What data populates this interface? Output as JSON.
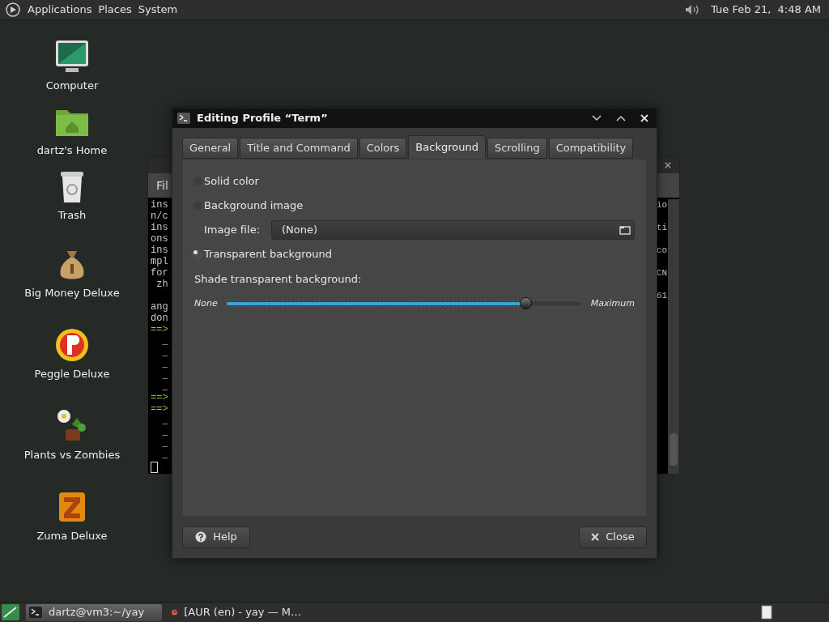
{
  "top_panel": {
    "menus": [
      "Applications",
      "Places",
      "System"
    ],
    "clock": "Tue Feb 21,  4:48 AM"
  },
  "desktop_icons": [
    {
      "label": "Computer",
      "kind": "computer"
    },
    {
      "label": "dartz's Home",
      "kind": "folder"
    },
    {
      "label": "Trash",
      "kind": "trash"
    },
    {
      "label": "Big Money Deluxe",
      "kind": "moneybag"
    },
    {
      "label": "Peggle Deluxe",
      "kind": "ball"
    },
    {
      "label": "Plants vs Zombies",
      "kind": "flower"
    },
    {
      "label": "Zuma Deluxe",
      "kind": "idol"
    }
  ],
  "terminal": {
    "menu": "Fil",
    "left_lines": [
      {
        "text": "ins",
        "kind": "text"
      },
      {
        "text": "n/c",
        "kind": "text"
      },
      {
        "text": "ins",
        "kind": "text"
      },
      {
        "text": "ons",
        "kind": "text"
      },
      {
        "text": "ins",
        "kind": "text"
      },
      {
        "text": "mpl",
        "kind": "text"
      },
      {
        "text": "for",
        "kind": "text"
      },
      {
        "text": " zh",
        "kind": "text"
      },
      {
        "kind": "blank"
      },
      {
        "text": "ang",
        "kind": "text"
      },
      {
        "text": "don",
        "kind": "text"
      },
      {
        "text": "==>",
        "kind": "arrow"
      },
      {
        "text": "  _",
        "kind": "text"
      },
      {
        "text": "  _",
        "kind": "text"
      },
      {
        "text": "  _",
        "kind": "text"
      },
      {
        "text": "  _",
        "kind": "text"
      },
      {
        "text": "  _",
        "kind": "text"
      },
      {
        "text": "==>",
        "kind": "arrow"
      },
      {
        "text": "==>",
        "kind": "arrow"
      },
      {
        "text": "  _",
        "kind": "text"
      },
      {
        "text": "  _",
        "kind": "text"
      },
      {
        "text": "  _",
        "kind": "text"
      },
      {
        "text": "  _",
        "kind": "text"
      }
    ],
    "right_lines": [
      {
        "text": "io",
        "kind": "text"
      },
      {
        "kind": "blank"
      },
      {
        "text": "ti",
        "kind": "text"
      },
      {
        "kind": "blank"
      },
      {
        "text": "co",
        "kind": "text"
      },
      {
        "kind": "blank"
      },
      {
        "text": "CN",
        "kind": "text"
      },
      {
        "kind": "blank"
      },
      {
        "text": "61",
        "kind": "text"
      }
    ]
  },
  "dialog": {
    "title": "Editing Profile “Term”",
    "tabs": [
      {
        "label": "General",
        "selected": false
      },
      {
        "label": "Title and Command",
        "selected": false
      },
      {
        "label": "Colors",
        "selected": false
      },
      {
        "label": "Background",
        "selected": true
      },
      {
        "label": "Scrolling",
        "selected": false
      },
      {
        "label": "Compatibility",
        "selected": false
      }
    ],
    "options": [
      {
        "label": "Solid color",
        "selected": false
      },
      {
        "label": "Background image",
        "selected": false
      },
      {
        "label": "Transparent background",
        "selected": true
      }
    ],
    "image_file": {
      "label": "Image file:",
      "value": "(None)"
    },
    "shade": {
      "label": "Shade transparent background:",
      "min_label": "None",
      "max_label": "Maximum",
      "level": 0.84
    },
    "buttons": [
      {
        "label": "Help",
        "kind": "help"
      },
      {
        "label": "Close",
        "kind": "close"
      }
    ]
  },
  "taskbar": [
    {
      "label": "dartz@vm3:~/yay",
      "selected": true,
      "kind": "terminal"
    },
    {
      "label": "[AUR (en) - yay — M…",
      "selected": false,
      "kind": "browser"
    }
  ]
}
